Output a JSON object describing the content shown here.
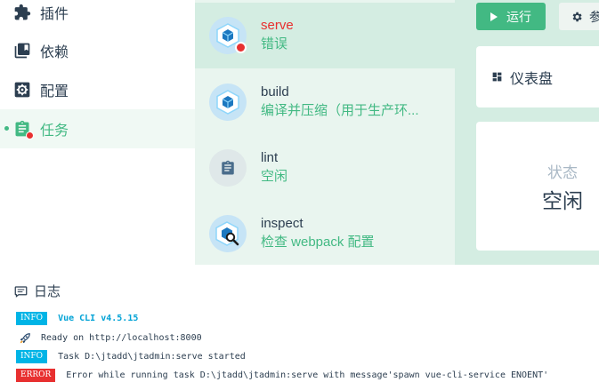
{
  "nav": {
    "items": [
      {
        "label": "插件",
        "icon": "puzzle-icon",
        "active": false
      },
      {
        "label": "依赖",
        "icon": "collection-icon",
        "active": false
      },
      {
        "label": "配置",
        "icon": "settings-box-icon",
        "active": false
      },
      {
        "label": "任务",
        "icon": "clipboard-icon",
        "active": true
      }
    ]
  },
  "tasks": [
    {
      "name": "serve",
      "description": "错误",
      "icon": "webpack-cube-icon",
      "status": "error",
      "selected": true
    },
    {
      "name": "build",
      "description": "编译并压缩（用于生产环...",
      "icon": "webpack-cube-icon",
      "selected": false
    },
    {
      "name": "lint",
      "description": "空闲",
      "icon": "clipboard-icon",
      "selected": false
    },
    {
      "name": "inspect",
      "description": "检查 webpack 配置",
      "icon": "webpack-inspect-icon",
      "selected": false
    }
  ],
  "panel": {
    "run_label": "运行",
    "params_label": "参",
    "dashboard_label": "仪表盘",
    "status_title": "状态",
    "status_value": "空闲"
  },
  "log": {
    "title": "日志",
    "lines": [
      {
        "tag": "INFO",
        "text": "Vue CLI v4.5.15"
      },
      {
        "icon": "rocket-icon",
        "text": "Ready on http://localhost:8000"
      },
      {
        "tag": "INFO",
        "text": "Task D:\\jtadd\\jtadmin:serve started"
      },
      {
        "tag": "ERROR",
        "text": "Error while running task D:\\jtadd\\jtadmin:serve with message'spawn vue-cli-service ENOENT'"
      }
    ]
  },
  "colors": {
    "accent": "#42b983",
    "error": "#e83030",
    "info": "#00b4e6",
    "task_list_bg": "#e9f5ef",
    "selected_bg": "#d4ede2"
  }
}
